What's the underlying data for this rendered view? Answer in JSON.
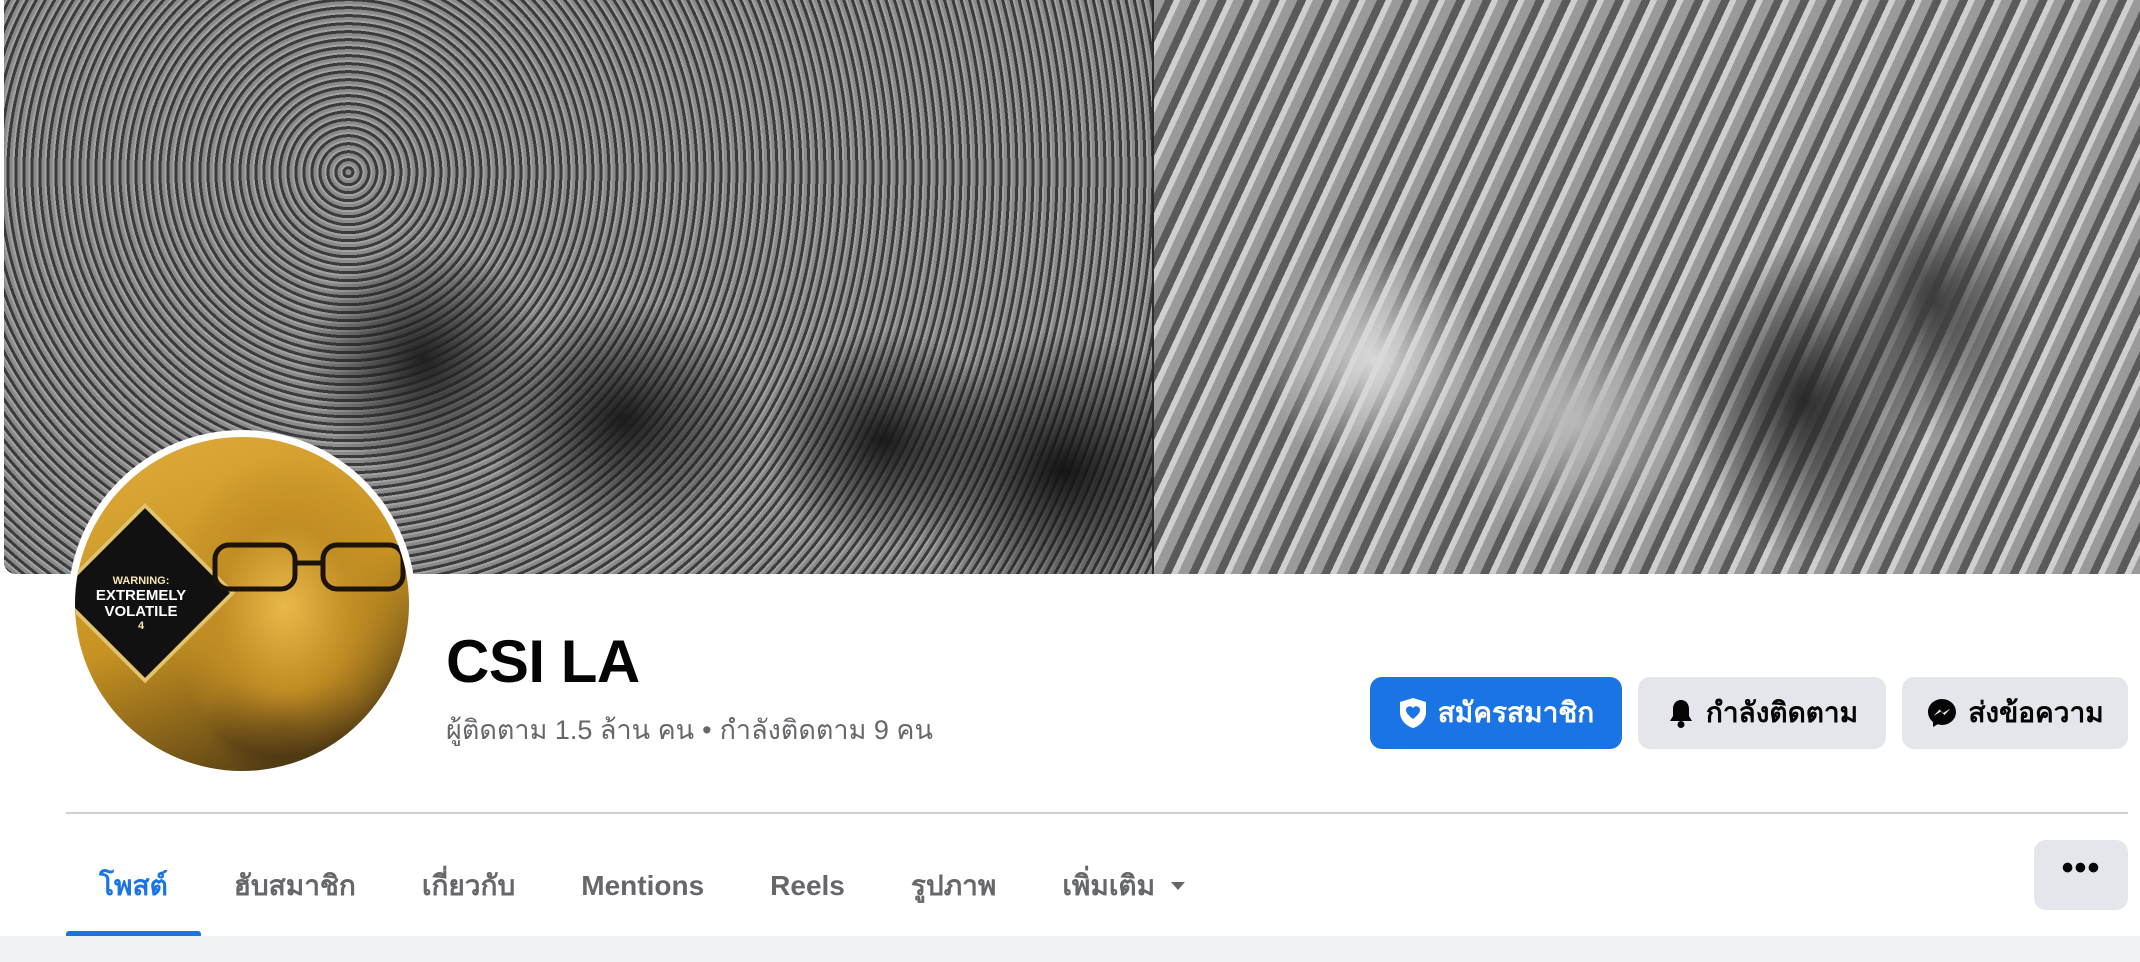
{
  "profile": {
    "name": "CSI LA",
    "followers": "ผู้ติดตาม 1.5 ล้าน คน",
    "separator": "•",
    "following": "กำลังติดตาม 9 คน",
    "avatar_badge": {
      "line1": "WARNING:",
      "line2": "EXTREMELY",
      "line3": "VOLATILE",
      "number": "4"
    }
  },
  "actions": {
    "subscribe": {
      "label": "สมัครสมาชิก",
      "icon": "shield-heart-icon",
      "color": "#1b74e4"
    },
    "following": {
      "label": "กำลังติดตาม",
      "icon": "bell-icon"
    },
    "message": {
      "label": "ส่งข้อความ",
      "icon": "messenger-icon"
    }
  },
  "tabs": [
    {
      "label": "โพสต์",
      "active": true
    },
    {
      "label": "ฮับสมาชิก",
      "active": false
    },
    {
      "label": "เกี่ยวกับ",
      "active": false
    },
    {
      "label": "Mentions",
      "active": false
    },
    {
      "label": "Reels",
      "active": false
    },
    {
      "label": "รูปภาพ",
      "active": false
    },
    {
      "label": "เพิ่มเติม",
      "active": false,
      "icon": "caret-down-icon"
    }
  ],
  "more_button": {
    "label": "•••",
    "icon": "more-dots-icon"
  },
  "colors": {
    "accent": "#1b74e4",
    "secondary_button": "#e4e6eb",
    "muted_text": "#65676b"
  }
}
